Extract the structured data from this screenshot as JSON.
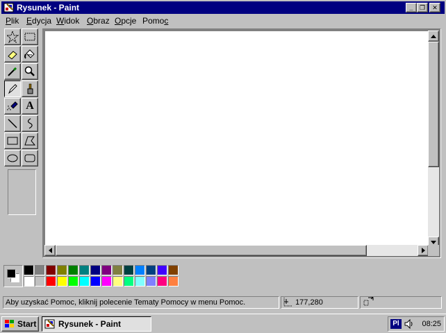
{
  "window": {
    "title": "Rysunek - Paint",
    "controls": {
      "minimize": "_",
      "maximize": "❐",
      "close": "✕"
    }
  },
  "menu": [
    {
      "label": "Plik",
      "accel_index": 0
    },
    {
      "label": "Edycja",
      "accel_index": 0
    },
    {
      "label": "Widok",
      "accel_index": 0
    },
    {
      "label": "Obraz",
      "accel_index": 0
    },
    {
      "label": "Opcje",
      "accel_index": 0
    },
    {
      "label": "Pomoc",
      "accel_index": 4
    }
  ],
  "tools": [
    {
      "name": "free-form-select",
      "icon": "star-select-icon",
      "pressed": false
    },
    {
      "name": "select",
      "icon": "rect-select-icon",
      "pressed": false
    },
    {
      "name": "eraser",
      "icon": "eraser-icon",
      "pressed": false
    },
    {
      "name": "fill",
      "icon": "paint-bucket-icon",
      "pressed": false
    },
    {
      "name": "pick-color",
      "icon": "eyedropper-icon",
      "pressed": false
    },
    {
      "name": "magnifier",
      "icon": "magnifier-icon",
      "pressed": false
    },
    {
      "name": "pencil",
      "icon": "pencil-icon",
      "pressed": true
    },
    {
      "name": "brush",
      "icon": "brush-icon",
      "pressed": false
    },
    {
      "name": "airbrush",
      "icon": "airbrush-icon",
      "pressed": false
    },
    {
      "name": "text",
      "icon": "text-icon",
      "label": "A",
      "pressed": false
    },
    {
      "name": "line",
      "icon": "line-icon",
      "pressed": false
    },
    {
      "name": "curve",
      "icon": "curve-icon",
      "pressed": false
    },
    {
      "name": "rectangle",
      "icon": "rectangle-icon",
      "pressed": false
    },
    {
      "name": "polygon",
      "icon": "polygon-icon",
      "pressed": false
    },
    {
      "name": "ellipse",
      "icon": "ellipse-icon",
      "pressed": false
    },
    {
      "name": "rounded-rectangle",
      "icon": "rounded-rectangle-icon",
      "pressed": false
    }
  ],
  "colors": {
    "foreground": "#000000",
    "background": "#ffffff",
    "palette_top": [
      "#000000",
      "#808080",
      "#800000",
      "#808000",
      "#008000",
      "#008080",
      "#000080",
      "#800080",
      "#808040",
      "#004040",
      "#0080ff",
      "#004080",
      "#4000ff",
      "#804000"
    ],
    "palette_bottom": [
      "#ffffff",
      "#c0c0c0",
      "#ff0000",
      "#ffff00",
      "#00ff00",
      "#00ffff",
      "#0000ff",
      "#ff00ff",
      "#ffff80",
      "#00ff80",
      "#80ffff",
      "#8080ff",
      "#ff0080",
      "#ff8040"
    ]
  },
  "status": {
    "help_text": "Aby uzyskać Pomoc, kliknij polecenie Tematy Pomocy w menu Pomoc.",
    "cursor_position": "177,280",
    "selection_size": ""
  },
  "taskbar": {
    "start_label": "Start",
    "task_label": "Rysunek - Paint",
    "language": "Pl",
    "clock": "08:25"
  }
}
